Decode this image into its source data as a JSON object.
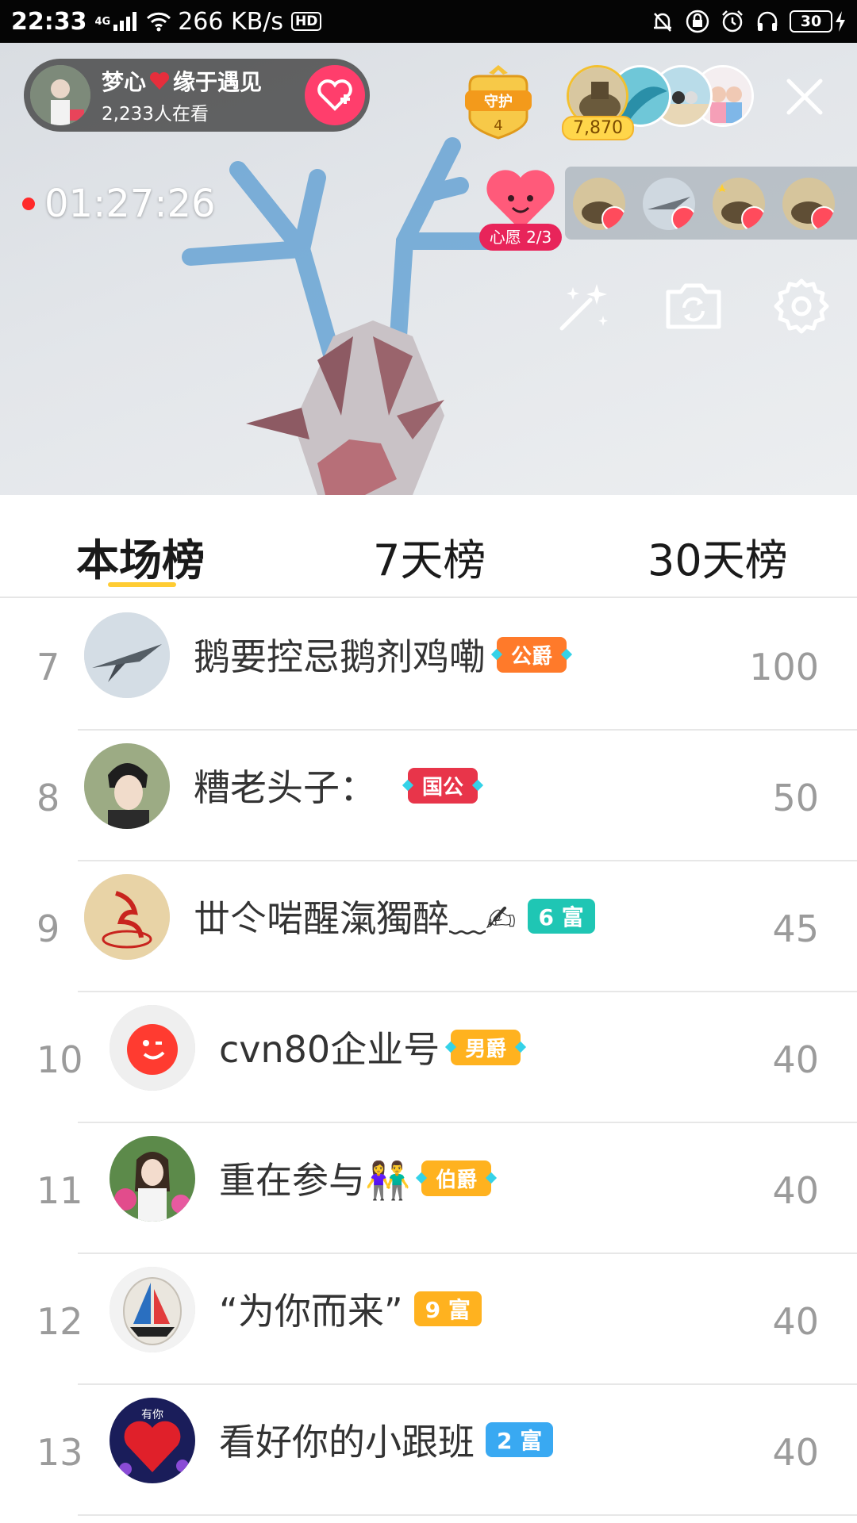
{
  "status_bar": {
    "time": "22:33",
    "network": "4G",
    "speed": "266 KB/s",
    "hd": "HD",
    "battery": "30"
  },
  "live": {
    "host_name_part1": "梦心",
    "host_name_part2": "缘于遇见",
    "viewers": "2,233人在看",
    "guard_label": "守护",
    "guard_count": "4",
    "fan_contribution": "7,870",
    "timer": "01:27:26",
    "wish_label": "心愿 2/3"
  },
  "tabs": [
    {
      "label": "本场榜",
      "active": true
    },
    {
      "label": "7天榜",
      "active": false
    },
    {
      "label": "30天榜",
      "active": false
    }
  ],
  "ranking": [
    {
      "rank": "7",
      "name": "鹅要控忌鹅剂鸡嘞",
      "badge": "公爵",
      "badge_type": "noble",
      "badge_color": "#ff7a2a",
      "score": "100"
    },
    {
      "rank": "8",
      "name": "糟老头子：",
      "badge": "国公",
      "badge_type": "noble",
      "badge_color": "#e8354a",
      "score": "50"
    },
    {
      "rank": "9",
      "name": "丗仒啱醒滊獨醉﹏✍",
      "badge": "6 富",
      "badge_type": "rich",
      "badge_color": "#1fc6b4",
      "score": "45"
    },
    {
      "rank": "10",
      "name": "cvn80企业号",
      "badge": "男爵",
      "badge_type": "noble",
      "badge_color": "#ffb21f",
      "score": "40"
    },
    {
      "rank": "11",
      "name": "重在参与👫",
      "badge": "伯爵",
      "badge_type": "noble",
      "badge_color": "#ffb21f",
      "score": "40"
    },
    {
      "rank": "12",
      "name": "“为你而来”",
      "badge": "9 富",
      "badge_type": "rich",
      "badge_color": "#ffb21f",
      "score": "40"
    },
    {
      "rank": "13",
      "name": "看好你的小跟班",
      "badge": "2 富",
      "badge_type": "rich",
      "badge_color": "#39a9f2",
      "score": "40"
    }
  ],
  "avatar_13_text": "有你",
  "colors": {
    "accent_yellow": "#ffcc33",
    "follow_pink": "#ff3e6c",
    "rank_gray": "#9b9b9b"
  }
}
